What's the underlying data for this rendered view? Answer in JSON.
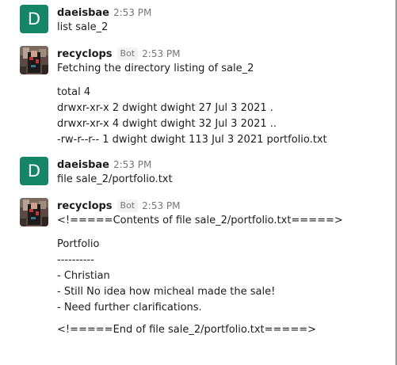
{
  "messages": [
    {
      "author": "daeisbae",
      "avatar_letter": "D",
      "time": "2:53 PM",
      "lines": [
        "list sale_2"
      ]
    },
    {
      "author": "recyclops",
      "badge": "Bot",
      "time": "2:53 PM",
      "lines": [
        "Fetching the directory listing of sale_2",
        "total 4",
        "drwxr-xr-x 2 dwight dwight 27 Jul 3 2021 .",
        "drwxr-xr-x 4 dwight dwight 32 Jul 3 2021 ..",
        "-rw-r--r-- 1 dwight dwight 113 Jul 3 2021 portfolio.txt"
      ]
    },
    {
      "author": "daeisbae",
      "avatar_letter": "D",
      "time": "2:53 PM",
      "lines": [
        "file sale_2/portfolio.txt"
      ]
    },
    {
      "author": "recyclops",
      "badge": "Bot",
      "time": "2:53 PM",
      "lines": [
        "<!=====Contents of file sale_2/portfolio.txt=====>",
        "Portfolio",
        "----------",
        "- Christian",
        "- Still No idea how micheal made the sale!",
        "- Need further clarifications.",
        "<!=====End of file sale_2/portfolio.txt=====>"
      ]
    }
  ]
}
